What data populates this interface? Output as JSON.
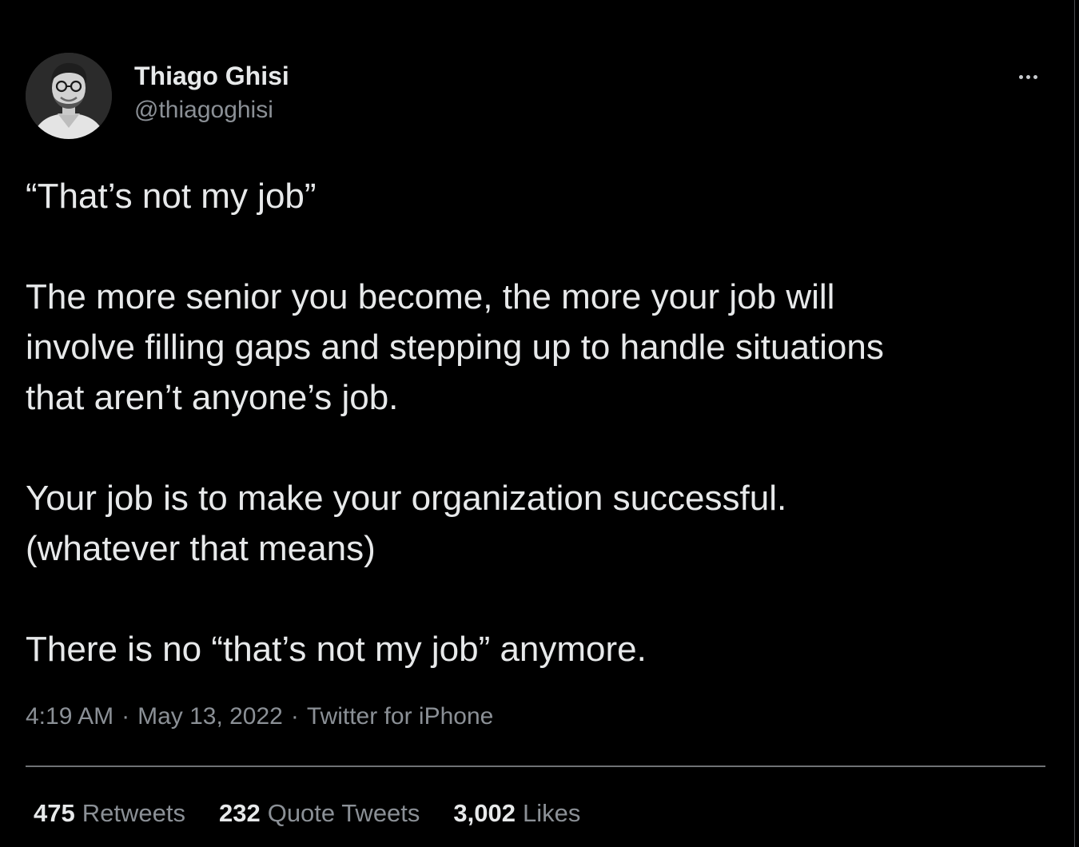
{
  "author": {
    "display_name": "Thiago Ghisi",
    "handle": "@thiagoghisi"
  },
  "tweet": {
    "paragraphs": [
      "“That’s not my job”",
      "The more senior you become, the more your job will\ninvolve filling gaps and stepping up to handle situations\nthat aren’t anyone’s job.",
      "Your job is to make your organization successful.\n(whatever that means)",
      "There is no “that’s not my job” anymore."
    ],
    "time": "4:19 AM",
    "date": "May 13, 2022",
    "source": "Twitter for iPhone",
    "separator": "·"
  },
  "stats": {
    "retweets": {
      "count": "475",
      "label": "Retweets"
    },
    "quote_tweets": {
      "count": "232",
      "label": "Quote Tweets"
    },
    "likes": {
      "count": "3,002",
      "label": "Likes"
    }
  },
  "icons": {
    "more": "more-horizontal-icon"
  },
  "colors": {
    "background": "#000000",
    "primary_text": "#e7e9ea",
    "secondary_text": "#8b9096",
    "divider": "#6f7275"
  }
}
